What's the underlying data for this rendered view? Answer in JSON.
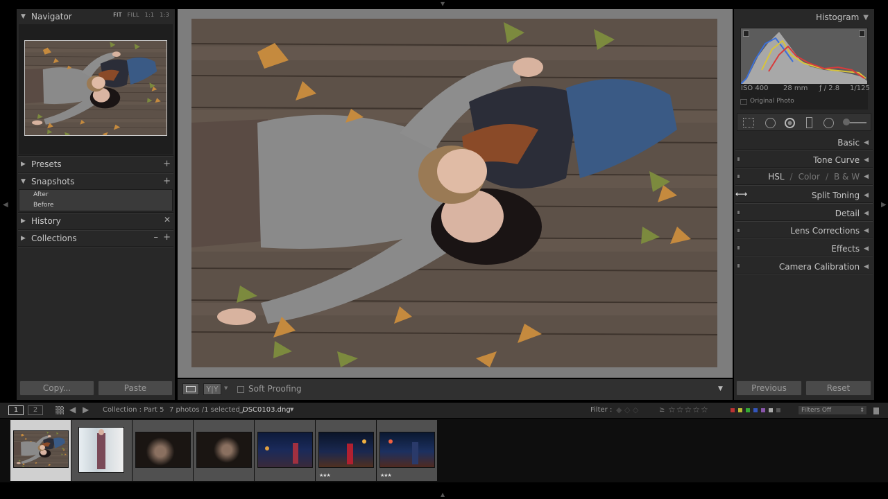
{
  "navigator": {
    "title": "Navigator",
    "zoom_fit": "FIT",
    "zoom_fill": "FILL",
    "zoom_1": "1:1",
    "zoom_2": "1:3"
  },
  "left_panels": {
    "presets": "Presets",
    "snapshots": "Snapshots",
    "snapshot_items": [
      "After",
      "Before"
    ],
    "history": "History",
    "collections": "Collections"
  },
  "left_buttons": {
    "copy": "Copy...",
    "paste": "Paste"
  },
  "toolbar": {
    "soft_proofing": "Soft Proofing",
    "yy": "Y|Y"
  },
  "right_panel": {
    "histogram": "Histogram",
    "iso": "ISO 400",
    "focal": "28 mm",
    "aperture": "ƒ / 2.8",
    "shutter": "1/125",
    "original_photo": "Original Photo",
    "sections": {
      "basic": "Basic",
      "tone_curve": "Tone Curve",
      "hsl": "HSL",
      "color": "Color",
      "bw": "B & W",
      "slash": "/",
      "split_toning": "Split Toning",
      "detail": "Detail",
      "lens_corrections": "Lens Corrections",
      "effects": "Effects",
      "camera_calibration": "Camera Calibration"
    }
  },
  "right_buttons": {
    "previous": "Previous",
    "reset": "Reset"
  },
  "filmbar": {
    "screen1": "1",
    "screen2": "2",
    "collection": "Collection : Part 5",
    "count": "7 photos /1 selected /",
    "filename": "_DSC0103.dng",
    "filter_label": "Filter :",
    "filters_off": "Filters Off"
  },
  "filmstrip": {
    "stars": [
      "",
      "",
      "",
      "",
      "",
      "★★★",
      "★★★"
    ]
  },
  "colors": {
    "panel_bg": "#282828",
    "center_bg": "#7d7d7d",
    "selected_cell": "#d0d0d0",
    "cell_bg": "#505050"
  }
}
